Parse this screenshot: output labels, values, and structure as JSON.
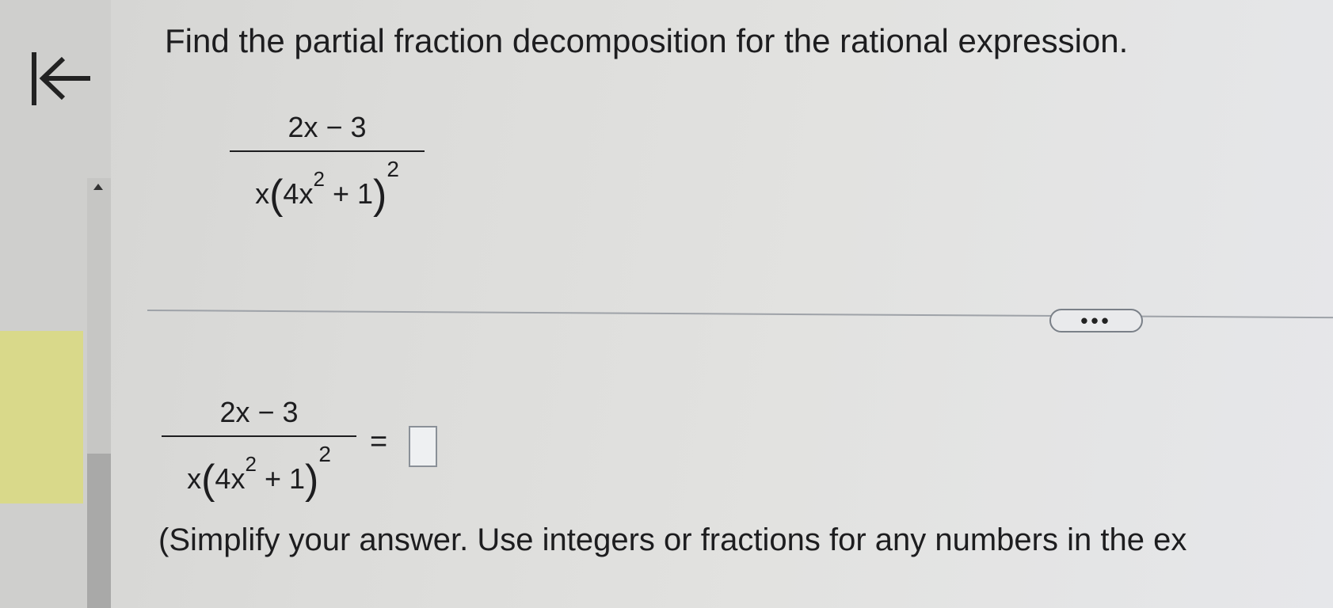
{
  "question": {
    "prompt": "Find the partial fraction decomposition for the rational expression."
  },
  "expression": {
    "numerator": "2x − 3",
    "den_x": "x",
    "den_open": "(",
    "den_inner": "4x",
    "den_inner_exp": "2",
    "den_plus": "+ 1",
    "den_close": ")",
    "den_outer_exp": "2"
  },
  "answer": {
    "equals": "=",
    "value": ""
  },
  "more_button": {
    "label": "•••"
  },
  "instruction": "(Simplify your answer. Use integers or fractions for any numbers in the ex"
}
